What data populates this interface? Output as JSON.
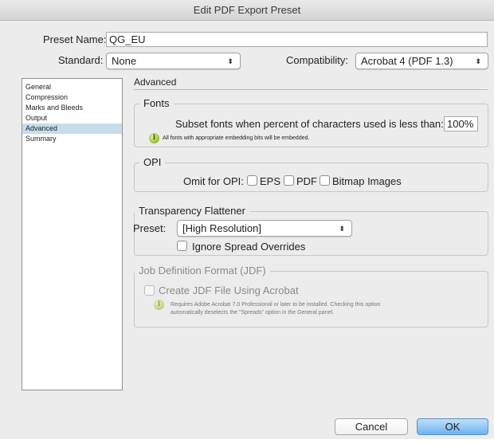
{
  "window": {
    "title": "Edit PDF Export Preset"
  },
  "preset_name": {
    "label": "Preset Name:",
    "value": "QG_EU"
  },
  "standard": {
    "label": "Standard:",
    "value": "None"
  },
  "compatibility": {
    "label": "Compatibility:",
    "value": "Acrobat 4 (PDF 1.3)"
  },
  "sidebar": {
    "items": [
      {
        "label": "General"
      },
      {
        "label": "Compression"
      },
      {
        "label": "Marks and Bleeds"
      },
      {
        "label": "Output"
      },
      {
        "label": "Advanced"
      },
      {
        "label": "Summary"
      }
    ],
    "selected": "Advanced"
  },
  "panel": {
    "title": "Advanced"
  },
  "fonts": {
    "title": "Fonts",
    "subset_label": "Subset fonts when percent of characters used is less than:",
    "subset_value": "100%",
    "info": "All fonts with appropriate embedding bits will be embedded."
  },
  "opi": {
    "title": "OPI",
    "omit_label": "Omit for OPI:",
    "eps_label": "EPS",
    "pdf_label": "PDF",
    "bitmap_label": "Bitmap Images"
  },
  "transparency": {
    "title": "Transparency Flattener",
    "preset_label": "Preset:",
    "preset_value": "[High Resolution]",
    "ignore_label": "Ignore Spread Overrides"
  },
  "jdf": {
    "title": "Job Definition Format (JDF)",
    "create_label": "Create JDF File Using Acrobat",
    "info_line1": "Requires Adobe Acrobat 7.0 Professional or later to be installed. Checking this option",
    "info_line2": "automatically deselects the \"Spreads\" option in the General panel."
  },
  "buttons": {
    "cancel": "Cancel",
    "ok": "OK"
  }
}
